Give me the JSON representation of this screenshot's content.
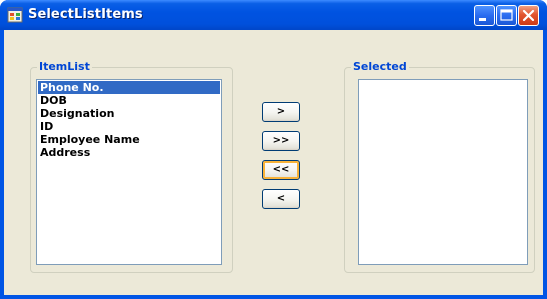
{
  "window": {
    "title": "SelectListItems",
    "app_icon": "windows-forms-app-icon",
    "controls": {
      "minimize_icon": "minimize-icon",
      "maximize_icon": "maximize-icon",
      "close_icon": "close-icon"
    },
    "colors": {
      "titlebar": "#0054e3",
      "frame": "#0055e5",
      "client_bg": "#ece9d8",
      "group_label": "#0046d5",
      "selection": "#316ac5",
      "close_button": "#e2552f"
    }
  },
  "item_list": {
    "label": "ItemList",
    "selected_index": 0,
    "items": [
      "Phone No.",
      "DOB",
      "Designation",
      "ID",
      "Employee Name",
      "Address"
    ]
  },
  "selected_list": {
    "label": "Selected",
    "items": []
  },
  "buttons": {
    "move_right": ">",
    "move_all_right": ">>",
    "move_all_left": "<<",
    "move_left": "<"
  }
}
